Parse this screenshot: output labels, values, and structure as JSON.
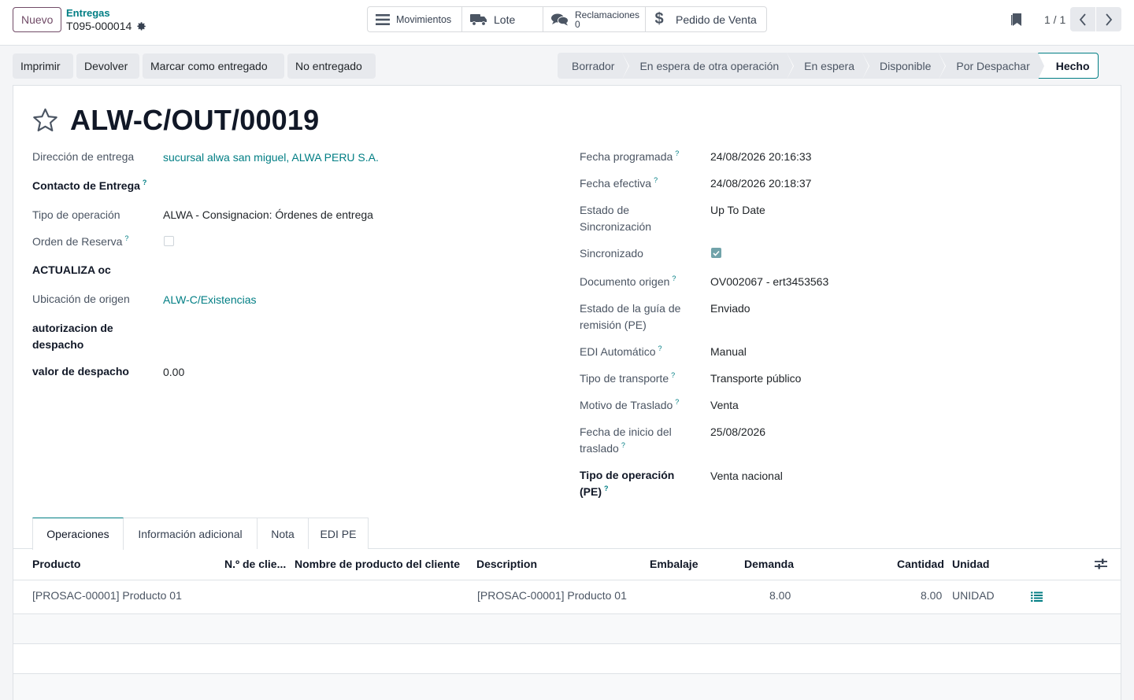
{
  "header": {
    "new_button": "Nuevo",
    "breadcrumb_parent": "Entregas",
    "breadcrumb_current": "T095-000014",
    "smart_buttons": {
      "movements": "Movimientos",
      "lot": "Lote",
      "claims_label": "Reclamaciones",
      "claims_count": "0",
      "sale_order": "Pedido de Venta"
    },
    "pager": "1 / 1"
  },
  "actions": {
    "print": "Imprimir",
    "return": "Devolver",
    "mark_delivered": "Marcar como entregado",
    "not_delivered": "No entregado"
  },
  "statusbar": {
    "stages": [
      "Borrador",
      "En espera de otra operación",
      "En espera",
      "Disponible",
      "Por Despachar",
      "Hecho"
    ],
    "active": "Hecho"
  },
  "record": {
    "title": "ALW-C/OUT/00019",
    "left": {
      "delivery_address_label": "Dirección de entrega",
      "delivery_address": "sucursal alwa san miguel, ALWA PERU S.A.",
      "delivery_contact_label": "Contacto de Entrega",
      "operation_type_label": "Tipo de operación",
      "operation_type": "ALWA - Consignacion: Órdenes de entrega",
      "reservation_order_label": "Orden de Reserva",
      "updates_oc_label": "ACTUALIZA oc",
      "source_location_label": "Ubicación de origen",
      "source_location": "ALW-C/Existencias",
      "dispatch_auth_label_1": "autorizacion de",
      "dispatch_auth_label_2": "despacho",
      "dispatch_value_label": "valor de despacho",
      "dispatch_value": "0.00"
    },
    "right": {
      "scheduled_date_label": "Fecha programada",
      "scheduled_date": "24/08/2026 20:16:33",
      "effective_date_label": "Fecha efectiva",
      "effective_date": "24/08/2026 20:18:37",
      "sync_state_label_1": "Estado de",
      "sync_state_label_2": "Sincronización",
      "sync_state": "Up To Date",
      "synced_label": "Sincronizado",
      "origin_doc_label": "Documento origen",
      "origin_doc": "OV002067 - ert3453563",
      "guide_state_label_1": "Estado de la guía de",
      "guide_state_label_2": "remisión (PE)",
      "guide_state": "Enviado",
      "edi_auto_label": "EDI Automático",
      "edi_auto": "Manual",
      "transport_type_label": "Tipo de transporte",
      "transport_type": "Transporte público",
      "transfer_reason_label": "Motivo de Traslado",
      "transfer_reason": "Venta",
      "transfer_start_label_1": "Fecha de inicio del",
      "transfer_start_label_2": "traslado",
      "transfer_start": "25/08/2026",
      "op_type_pe_label_1": "Tipo de operación",
      "op_type_pe_label_2": "(PE)",
      "op_type_pe": "Venta nacional"
    }
  },
  "tabs": [
    "Operaciones",
    "Información adicional",
    "Nota",
    "EDI PE"
  ],
  "table": {
    "columns": [
      "Producto",
      "N.º de clie...",
      "Nombre de producto del cliente",
      "Description",
      "Embalaje",
      "Demanda",
      "Cantidad",
      "Unidad"
    ],
    "rows": [
      {
        "product": "[PROSAC-00001] Producto 01",
        "client_no": "",
        "client_product_name": "",
        "description": "[PROSAC-00001] Producto 01",
        "packaging": "",
        "demand": "8.00",
        "quantity": "8.00",
        "unit": "UNIDAD"
      }
    ]
  },
  "colors": {
    "primary": "#714b67",
    "link": "#017e84",
    "muted_bg": "#e7e9ed"
  }
}
